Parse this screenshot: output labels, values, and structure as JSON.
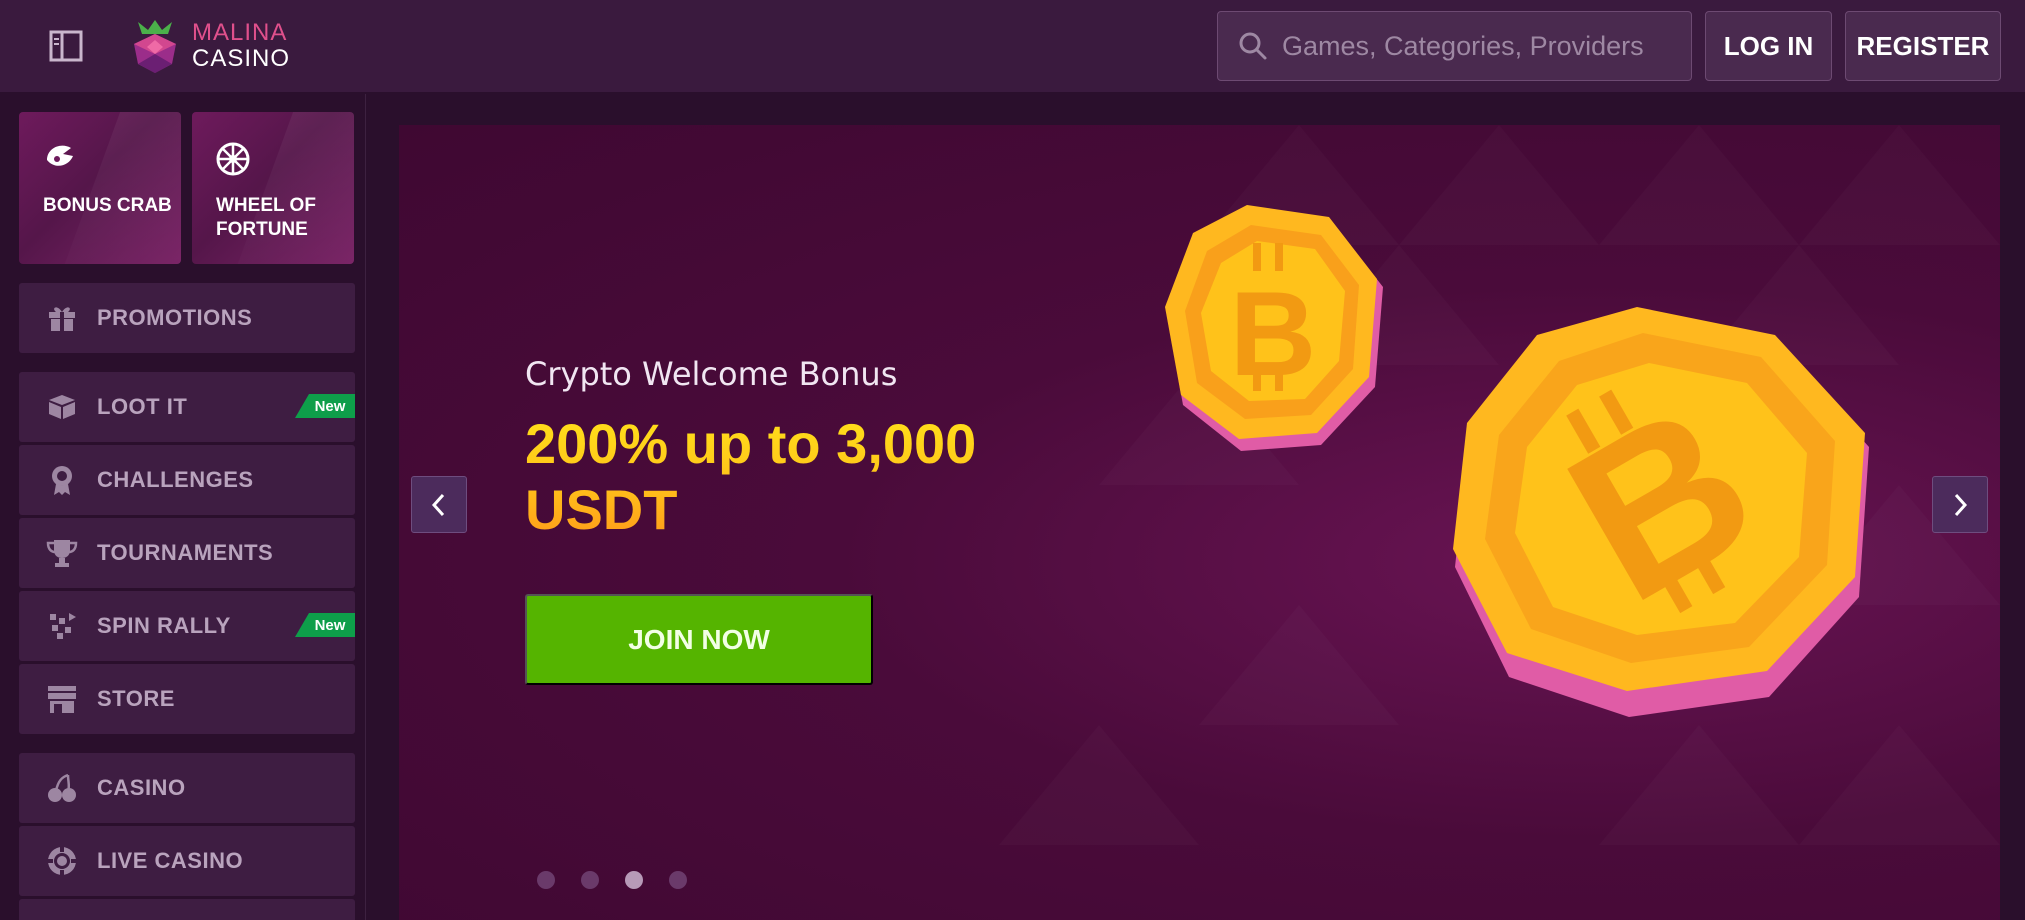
{
  "header": {
    "logo_line1": "MALINA",
    "logo_line2": "CASINO",
    "search_placeholder": "Games, Categories, Providers",
    "login_label": "LOG IN",
    "register_label": "REGISTER"
  },
  "sidebar": {
    "tiles": [
      {
        "label": "BONUS CRAB",
        "icon": "crab-claw-icon"
      },
      {
        "label": "WHEEL OF FORTUNE",
        "icon": "wheel-icon"
      }
    ],
    "items": [
      {
        "label": "PROMOTIONS",
        "icon": "gift-icon",
        "badge": ""
      },
      {
        "label": "LOOT IT",
        "icon": "loot-box-icon",
        "badge": "New"
      },
      {
        "label": "CHALLENGES",
        "icon": "medal-icon",
        "badge": ""
      },
      {
        "label": "TOURNAMENTS",
        "icon": "trophy-icon",
        "badge": ""
      },
      {
        "label": "SPIN RALLY",
        "icon": "rally-icon",
        "badge": "New"
      },
      {
        "label": "STORE",
        "icon": "store-icon",
        "badge": ""
      },
      {
        "label": "CASINO",
        "icon": "cherries-icon",
        "badge": ""
      },
      {
        "label": "LIVE CASINO",
        "icon": "chip-icon",
        "badge": ""
      }
    ]
  },
  "banner": {
    "subtitle": "Crypto Welcome Bonus",
    "title": "200% up to 3,000 USDT",
    "cta_label": "JOIN NOW",
    "slides_count": 4,
    "active_slide": 3
  },
  "colors": {
    "header_bg": "#3a1a3e",
    "page_bg": "#2a0f2c",
    "accent_pink": "#e0508c",
    "cta_green": "#55b400",
    "badge_green": "#0e9e4a",
    "title_gold": "#ffc21a"
  }
}
